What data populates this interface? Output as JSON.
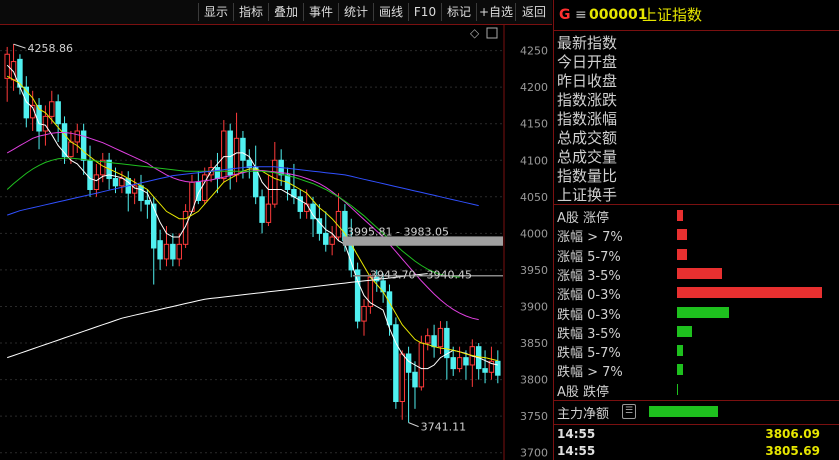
{
  "toolbar": {
    "items": [
      "显示",
      "指标",
      "叠加",
      "事件",
      "统计",
      "画线",
      "F10",
      "标记",
      "+自选",
      "返回"
    ]
  },
  "index": {
    "prefix": "G",
    "menu_glyph": "≡",
    "code": "000001",
    "name": "上证指数"
  },
  "info_labels": [
    "最新指数",
    "今日开盘",
    "昨日收盘",
    "指数涨跌",
    "指数涨幅",
    "总成交额",
    "总成交量",
    "指数量比",
    "上证换手"
  ],
  "distribution": [
    {
      "label": "A股 涨停",
      "value": 0.04,
      "color": "#e83030"
    },
    {
      "label": "涨幅 > 7%",
      "value": 0.07,
      "color": "#e83030"
    },
    {
      "label": "涨幅 5-7%",
      "value": 0.07,
      "color": "#e83030"
    },
    {
      "label": "涨幅 3-5%",
      "value": 0.31,
      "color": "#e83030"
    },
    {
      "label": "涨幅 0-3%",
      "value": 1.0,
      "color": "#e83030"
    },
    {
      "label": "跌幅 0-3%",
      "value": 0.36,
      "color": "#1ec01e"
    },
    {
      "label": "跌幅 3-5%",
      "value": 0.1,
      "color": "#1ec01e"
    },
    {
      "label": "跌幅 5-7%",
      "value": 0.04,
      "color": "#1ec01e"
    },
    {
      "label": "跌幅 > 7%",
      "value": 0.04,
      "color": "#1ec01e"
    },
    {
      "label": "A股 跌停",
      "value": 0.01,
      "color": "#1ec01e"
    }
  ],
  "net_flow": {
    "label": "主力净额",
    "icon": "list-icon",
    "value": 0.6,
    "color": "#1ec01e"
  },
  "ticks": [
    {
      "time": "14:55",
      "value": "3806.09"
    },
    {
      "time": "14:55",
      "value": "3805.69"
    }
  ],
  "chart_data": {
    "type": "candlestick",
    "y_ticks": [
      "4250",
      "4200",
      "4150",
      "4100",
      "4050",
      "4000",
      "3950",
      "3900",
      "3850",
      "3800",
      "3750",
      "3700"
    ],
    "ylim": [
      3690,
      4285
    ],
    "annotations": {
      "high": "4258.86",
      "low": "3741.11",
      "gap1": "3995.81 - 3983.05",
      "gap2": "3943.70 - 3940.45"
    },
    "candles": [
      [
        4212,
        4245,
        4255,
        4180
      ],
      [
        4210,
        4235,
        4259,
        4195
      ],
      [
        4238,
        4200,
        4245,
        4190
      ],
      [
        4200,
        4158,
        4215,
        4145
      ],
      [
        4158,
        4175,
        4195,
        4140
      ],
      [
        4175,
        4140,
        4185,
        4115
      ],
      [
        4140,
        4160,
        4175,
        4120
      ],
      [
        4160,
        4180,
        4195,
        4150
      ],
      [
        4180,
        4150,
        4190,
        4125
      ],
      [
        4150,
        4105,
        4160,
        4095
      ],
      [
        4105,
        4125,
        4140,
        4095
      ],
      [
        4125,
        4140,
        4150,
        4110
      ],
      [
        4140,
        4100,
        4150,
        4080
      ],
      [
        4100,
        4060,
        4120,
        4050
      ],
      [
        4060,
        4080,
        4095,
        4050
      ],
      [
        4080,
        4100,
        4110,
        4070
      ],
      [
        4100,
        4075,
        4110,
        4060
      ],
      [
        4075,
        4065,
        4090,
        4055
      ],
      [
        4065,
        4075,
        4085,
        4055
      ],
      [
        4075,
        4055,
        4085,
        4030
      ],
      [
        4055,
        4065,
        4075,
        4040
      ],
      [
        4065,
        4045,
        4080,
        4030
      ],
      [
        4045,
        4040,
        4060,
        4020
      ],
      [
        4040,
        3980,
        4050,
        3930
      ],
      [
        3990,
        3965,
        4005,
        3950
      ],
      [
        3965,
        3985,
        4010,
        3955
      ],
      [
        3985,
        3965,
        4000,
        3955
      ],
      [
        3965,
        3985,
        4000,
        3955
      ],
      [
        3985,
        4030,
        4040,
        3980
      ],
      [
        4030,
        4070,
        4080,
        4030
      ],
      [
        4070,
        4045,
        4085,
        4040
      ],
      [
        4045,
        4080,
        4090,
        4040
      ],
      [
        4080,
        4090,
        4100,
        4070
      ],
      [
        4090,
        4075,
        4110,
        4055
      ],
      [
        4075,
        4140,
        4155,
        4070
      ],
      [
        4140,
        4080,
        4150,
        4060
      ],
      [
        4080,
        4130,
        4165,
        4070
      ],
      [
        4130,
        4100,
        4140,
        4075
      ],
      [
        4100,
        4090,
        4115,
        4075
      ],
      [
        4090,
        4050,
        4120,
        4040
      ],
      [
        4050,
        4015,
        4060,
        4000
      ],
      [
        4015,
        4040,
        4080,
        4010
      ],
      [
        4040,
        4100,
        4125,
        4035
      ],
      [
        4100,
        4080,
        4115,
        4065
      ],
      [
        4080,
        4060,
        4090,
        4045
      ],
      [
        4060,
        4050,
        4095,
        4040
      ],
      [
        4050,
        4030,
        4060,
        4020
      ],
      [
        4030,
        4040,
        4060,
        4020
      ],
      [
        4040,
        4020,
        4050,
        3995
      ],
      [
        4020,
        4000,
        4040,
        3990
      ],
      [
        4000,
        3985,
        4030,
        3975
      ],
      [
        3985,
        3995,
        4010,
        3970
      ],
      [
        3995,
        4030,
        4055,
        3990
      ],
      [
        4030,
        3990,
        4040,
        3975
      ],
      [
        3990,
        3950,
        4020,
        3940
      ],
      [
        3950,
        3880,
        3960,
        3870
      ],
      [
        3880,
        3900,
        3910,
        3860
      ],
      [
        3900,
        3940,
        3945,
        3890
      ],
      [
        3940,
        3935,
        3950,
        3920
      ],
      [
        3935,
        3920,
        3945,
        3905
      ],
      [
        3920,
        3875,
        3930,
        3860
      ],
      [
        3875,
        3770,
        3885,
        3760
      ],
      [
        3770,
        3835,
        3840,
        3745
      ],
      [
        3835,
        3810,
        3845,
        3741
      ],
      [
        3810,
        3790,
        3825,
        3760
      ],
      [
        3790,
        3850,
        3860,
        3785
      ],
      [
        3850,
        3860,
        3870,
        3840
      ],
      [
        3860,
        3845,
        3875,
        3830
      ],
      [
        3845,
        3870,
        3880,
        3835
      ],
      [
        3870,
        3830,
        3880,
        3800
      ],
      [
        3830,
        3815,
        3845,
        3805
      ],
      [
        3815,
        3830,
        3845,
        3810
      ],
      [
        3830,
        3820,
        3840,
        3800
      ],
      [
        3820,
        3845,
        3855,
        3790
      ],
      [
        3845,
        3815,
        3850,
        3800
      ],
      [
        3815,
        3810,
        3840,
        3795
      ],
      [
        3810,
        3825,
        3845,
        3800
      ],
      [
        3825,
        3806,
        3840,
        3795
      ]
    ],
    "ma": [
      {
        "name": "MA5",
        "color": "#ffffff",
        "values": [
          4230,
          4221,
          4200,
          4180,
          4172,
          4150,
          4148,
          4135,
          4120,
          4110,
          4100,
          4095,
          4085,
          4075,
          4072,
          4078,
          4080,
          4078,
          4076,
          4070,
          4062,
          4060,
          4055,
          4035,
          4015,
          4000,
          3995,
          3995,
          4010,
          4030,
          4055,
          4070,
          4085,
          4095,
          4105,
          4105,
          4110,
          4110,
          4105,
          4090,
          4070,
          4060,
          4060,
          4060,
          4055,
          4050,
          4045,
          4040,
          4025,
          4015,
          4005,
          4000,
          3990,
          3985,
          3960,
          3935,
          3915,
          3905,
          3900,
          3895,
          3870,
          3850,
          3835,
          3825,
          3820,
          3815,
          3815,
          3820,
          3830,
          3835,
          3840,
          3838,
          3836,
          3832,
          3830,
          3826,
          3822,
          3820
        ]
      },
      {
        "name": "MA10",
        "color": "#e8e800",
        "values": [
          4215,
          4210,
          4205,
          4195,
          4185,
          4170,
          4165,
          4155,
          4145,
          4135,
          4125,
          4120,
          4112,
          4105,
          4098,
          4092,
          4088,
          4084,
          4080,
          4075,
          4070,
          4065,
          4060,
          4050,
          4040,
          4030,
          4025,
          4020,
          4020,
          4025,
          4030,
          4040,
          4050,
          4060,
          4070,
          4075,
          4080,
          4085,
          4088,
          4088,
          4085,
          4080,
          4075,
          4072,
          4070,
          4065,
          4060,
          4055,
          4045,
          4035,
          4028,
          4020,
          4010,
          4000,
          3985,
          3970,
          3955,
          3940,
          3930,
          3920,
          3905,
          3890,
          3875,
          3865,
          3855,
          3850,
          3848,
          3845,
          3843,
          3842,
          3840,
          3838,
          3835,
          3833,
          3831,
          3830,
          3828,
          3826
        ]
      },
      {
        "name": "MA20",
        "color": "#e040e0",
        "values": [
          4110,
          4115,
          4120,
          4125,
          4130,
          4133,
          4135,
          4137,
          4138,
          4138,
          4137,
          4135,
          4133,
          4130,
          4127,
          4124,
          4120,
          4116,
          4112,
          4108,
          4104,
          4100,
          4096,
          4090,
          4085,
          4080,
          4076,
          4073,
          4071,
          4070,
          4071,
          4072,
          4073,
          4075,
          4077,
          4079,
          4081,
          4083,
          4085,
          4086,
          4086,
          4085,
          4084,
          4083,
          4082,
          4080,
          4078,
          4075,
          4072,
          4068,
          4063,
          4057,
          4050,
          4043,
          4035,
          4027,
          4019,
          4011,
          4003,
          3995,
          3985,
          3975,
          3965,
          3955,
          3945,
          3935,
          3926,
          3917,
          3909,
          3902,
          3896,
          3891,
          3887,
          3884,
          3882
        ]
      },
      {
        "name": "MA30",
        "color": "#20c020",
        "values": [
          4060,
          4068,
          4075,
          4082,
          4088,
          4093,
          4097,
          4100,
          4102,
          4103,
          4103,
          4102,
          4101,
          4100,
          4099,
          4098,
          4097,
          4096,
          4095,
          4094,
          4093,
          4092,
          4091,
          4090,
          4089,
          4088,
          4087,
          4086,
          4085,
          4085,
          4085,
          4085,
          4085,
          4085,
          4085,
          4085,
          4085,
          4085,
          4085,
          4085,
          4085,
          4084,
          4083,
          4081,
          4079,
          4077,
          4074,
          4071,
          4068,
          4064,
          4060,
          4055,
          4050,
          4044,
          4038,
          4031,
          4024,
          4016,
          4008,
          4000,
          3992,
          3984,
          3976,
          3969,
          3962,
          3956,
          3951,
          3947,
          3944,
          3942,
          3941,
          3940
        ]
      },
      {
        "name": "MA60",
        "color": "#3050ff",
        "values": [
          4025,
          4028,
          4031,
          4033,
          4035,
          4037,
          4039,
          4041,
          4043,
          4045,
          4047,
          4049,
          4051,
          4053,
          4055,
          4057,
          4059,
          4061,
          4063,
          4065,
          4067,
          4069,
          4071,
          4073,
          4075,
          4077,
          4079,
          4080,
          4081,
          4082,
          4083,
          4084,
          4085,
          4086,
          4087,
          4088,
          4089,
          4090,
          4091,
          4091,
          4091,
          4091,
          4091,
          4090,
          4089,
          4088,
          4087,
          4086,
          4085,
          4084,
          4083,
          4082,
          4081,
          4080,
          4078,
          4076,
          4074,
          4072,
          4070,
          4068,
          4066,
          4064,
          4062,
          4060,
          4058,
          4056,
          4054,
          4052,
          4050,
          4048,
          4046,
          4044,
          4042,
          4040,
          4038
        ]
      },
      {
        "name": "MA250",
        "color": "#ffffff",
        "values": [
          3830,
          3833,
          3836,
          3839,
          3842,
          3845,
          3848,
          3851,
          3854,
          3857,
          3860,
          3863,
          3866,
          3869,
          3872,
          3875,
          3878,
          3881,
          3884,
          3886,
          3888,
          3890,
          3892,
          3894,
          3896,
          3898,
          3900,
          3902,
          3904,
          3906,
          3908,
          3910,
          3911,
          3912,
          3913,
          3914,
          3915,
          3916,
          3917,
          3918,
          3919,
          3920,
          3921,
          3922,
          3923,
          3924,
          3925,
          3926,
          3927,
          3928,
          3929,
          3930,
          3931,
          3932,
          3933,
          3934,
          3935,
          3936,
          3937,
          3938,
          3939,
          3940,
          3941,
          3942,
          3943,
          3944,
          3945
        ]
      }
    ]
  }
}
